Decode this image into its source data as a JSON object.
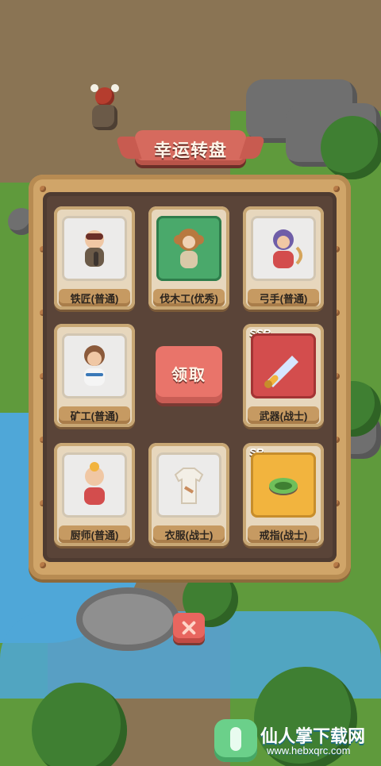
{
  "dialog": {
    "title": "幸运转盘",
    "claim_label": "领取"
  },
  "rewards": [
    {
      "label": "铁匠(普通)",
      "rarity": "",
      "card_color": "#ecebea",
      "icon": "blacksmith-character-icon"
    },
    {
      "label": "伐木工(优秀)",
      "rarity": "",
      "card_color": "#4aa96b",
      "icon": "lumberjack-monkey-icon"
    },
    {
      "label": "弓手(普通)",
      "rarity": "",
      "card_color": "#ecebea",
      "icon": "archer-character-icon"
    },
    {
      "label": "矿工(普通)",
      "rarity": "",
      "card_color": "#ecebea",
      "icon": "miner-character-icon"
    },
    {
      "label": "武器(战士)",
      "rarity": "SSR",
      "card_color": "#d34d4d",
      "icon": "sword-icon"
    },
    {
      "label": "厨师(普通)",
      "rarity": "",
      "card_color": "#ecebea",
      "icon": "chef-character-icon"
    },
    {
      "label": "衣服(战士)",
      "rarity": "",
      "card_color": "#ecebea",
      "icon": "shirt-icon"
    },
    {
      "label": "戒指(战士)",
      "rarity": "SR",
      "card_color": "#f2b43e",
      "icon": "ring-icon"
    }
  ],
  "watermark": {
    "text": "仙人掌下载网",
    "url": "www.hebxqrc.com"
  },
  "colors": {
    "board": "#d0a569",
    "inner": "#5a4438",
    "banner": "#d66a5e",
    "claim_button": "#e9746a",
    "close_button": "#e8665f"
  }
}
